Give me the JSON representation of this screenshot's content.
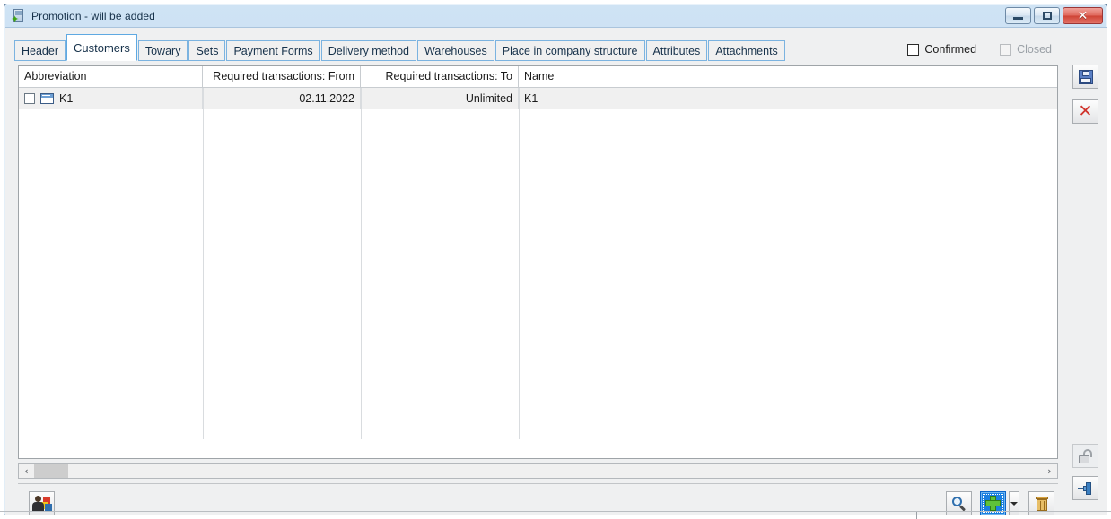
{
  "window": {
    "title": "Promotion - will be added",
    "icon": "promotion-document-icon",
    "minimize_label": "",
    "maximize_label": "",
    "close_label": "✕"
  },
  "tabs": [
    {
      "label": "Header",
      "active": false
    },
    {
      "label": "Customers",
      "active": true
    },
    {
      "label": "Towary",
      "active": false
    },
    {
      "label": "Sets",
      "active": false
    },
    {
      "label": "Payment Forms",
      "active": false
    },
    {
      "label": "Delivery method",
      "active": false
    },
    {
      "label": "Warehouses",
      "active": false
    },
    {
      "label": "Place in company structure",
      "active": false
    },
    {
      "label": "Attributes",
      "active": false
    },
    {
      "label": "Attachments",
      "active": false
    }
  ],
  "status_checks": {
    "confirmed_label": "Confirmed",
    "confirmed_checked": false,
    "confirmed_disabled": false,
    "closed_label": "Closed",
    "closed_checked": false,
    "closed_disabled": true
  },
  "grid": {
    "columns": [
      {
        "label": "Abbreviation",
        "align": "left"
      },
      {
        "label": "Required transactions: From",
        "align": "right"
      },
      {
        "label": "Required transactions: To",
        "align": "right"
      },
      {
        "label": "Name",
        "align": "left"
      }
    ],
    "rows": [
      {
        "selected": true,
        "checked": false,
        "abbreviation": "K1",
        "required_from": "02.11.2022",
        "required_to": "Unlimited",
        "name": "K1"
      }
    ]
  },
  "scrollbar": {
    "left_arrow": "‹",
    "right_arrow": "›"
  },
  "bottom_toolbar": {
    "contractor_button": "contractor-icon",
    "search_button": "search-icon",
    "add_button": "add-icon",
    "add_dropdown": "chevron-down-icon",
    "delete_button": "delete-icon"
  },
  "right_rail": {
    "save_button": "save-icon",
    "cancel_button": "cancel-icon",
    "lock_button": "unlock-icon",
    "pin_button": "pin-icon"
  },
  "colors": {
    "window_frame": "#bdd8ee",
    "accent_blue": "#1a7fe0",
    "tab_border": "#7bb3e0",
    "row_selected": "#f0f0f0",
    "close_red": "#cf4335"
  }
}
